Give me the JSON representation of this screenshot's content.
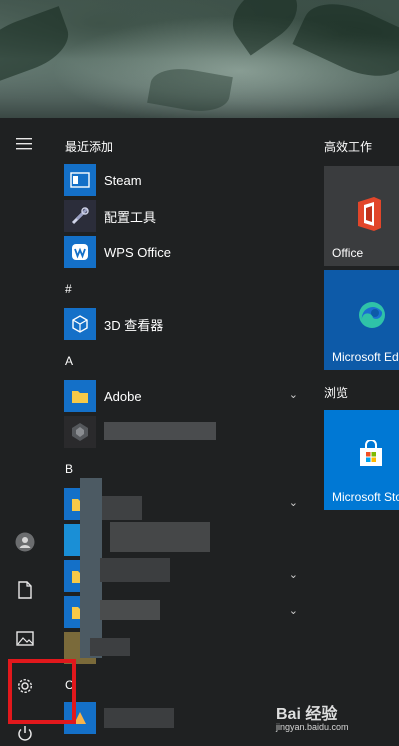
{
  "app_list": {
    "recent_header": "最近添加",
    "recent_items": [
      {
        "label": "Steam",
        "icon": "steam-icon"
      },
      {
        "label": "配置工具",
        "icon": "config-tool-icon"
      },
      {
        "label": "WPS Office",
        "icon": "wps-office-icon"
      }
    ],
    "hash_header": "#",
    "hash_items": [
      {
        "label": "3D 查看器",
        "icon": "3d-viewer-icon"
      }
    ],
    "a_header": "A",
    "a_items": [
      {
        "label": "Adobe",
        "icon": "folder-icon"
      }
    ],
    "b_header": "B",
    "c_header": "C"
  },
  "tiles": {
    "group1_title": "高效工作",
    "office_label": "Office",
    "edge_label": "Microsoft Ed",
    "group2_title": "浏览",
    "store_label": "Microsoft Sto"
  },
  "colors": {
    "accent_blue": "#0078d4",
    "tile_gray": "#3a3c3e",
    "highlight_red": "#e1181c"
  },
  "watermark": {
    "brand": "Bai 经验",
    "url": "jingyan.baidu.com"
  }
}
